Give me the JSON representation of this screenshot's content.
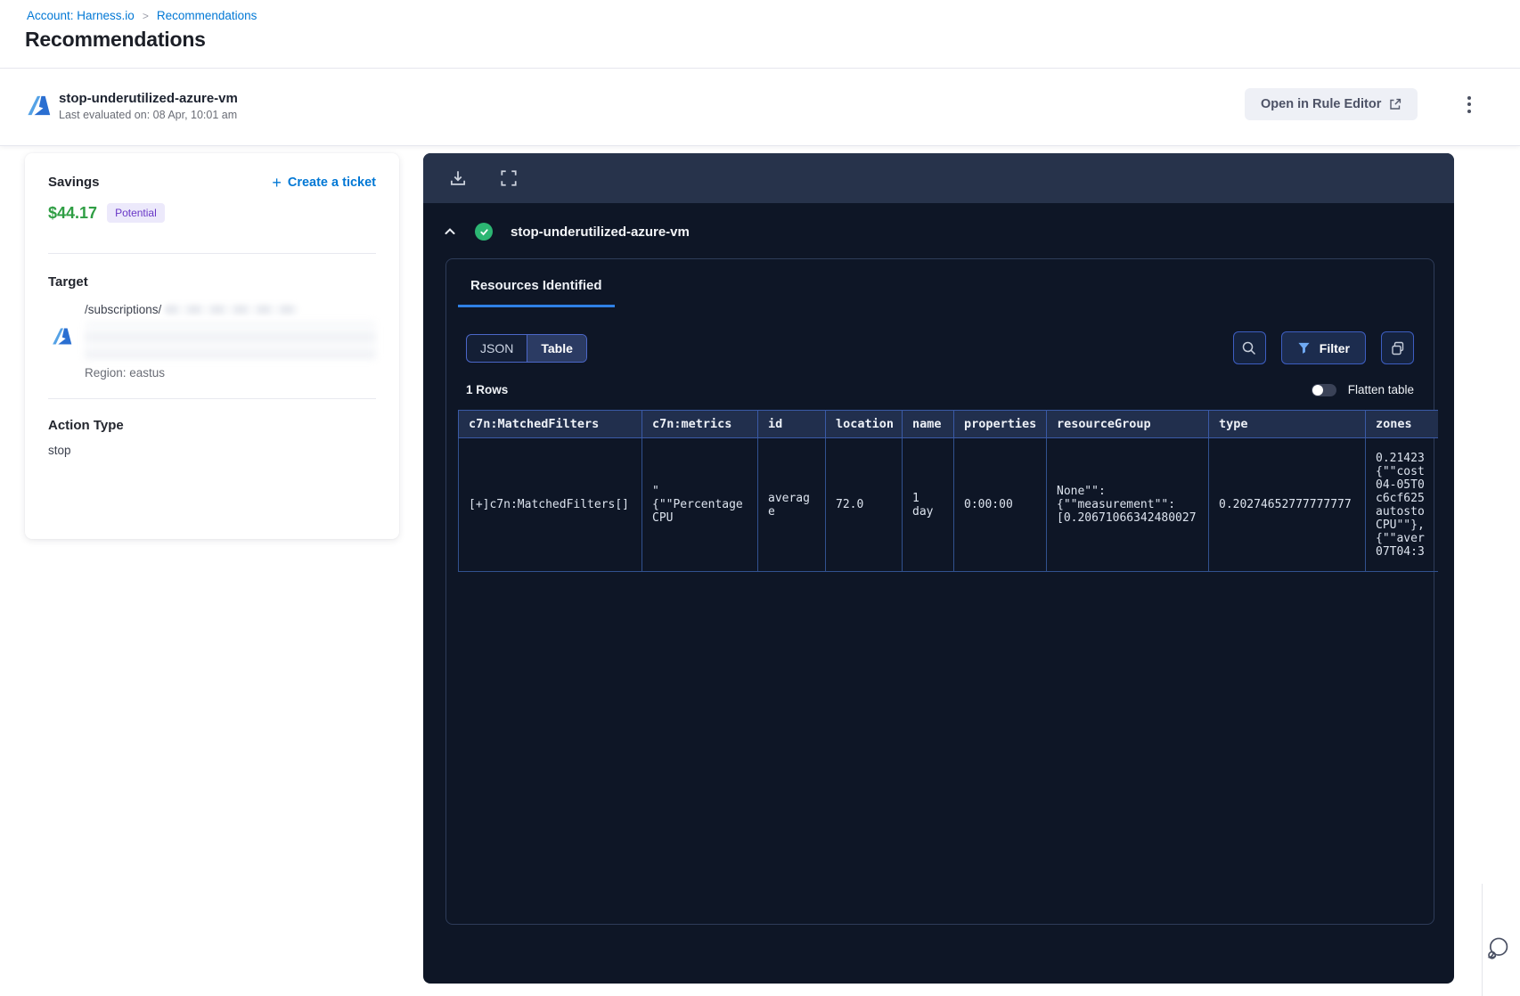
{
  "breadcrumb": {
    "account": "Account: Harness.io",
    "separator": ">",
    "current": "Recommendations"
  },
  "page": {
    "title": "Recommendations"
  },
  "recommendation_header": {
    "title": "stop-underutilized-azure-vm",
    "last_evaluated": "Last evaluated on: 08 Apr, 10:01 am",
    "open_rule_editor": "Open in Rule Editor"
  },
  "savings_card": {
    "savings_label": "Savings",
    "amount": "$44.17",
    "badge": "Potential",
    "plus": "+",
    "create_ticket": "Create a ticket",
    "target_label": "Target",
    "target_path": "/subscriptions/",
    "region": "Region: eastus",
    "action_type_label": "Action Type",
    "action_type_value": "stop"
  },
  "viewer": {
    "rule_title": "stop-underutilized-azure-vm",
    "tab_resources": "Resources Identified",
    "view_toggle": {
      "json": "JSON",
      "table": "Table",
      "selected": "Table"
    },
    "filter_label": "Filter",
    "rows_count": "1 Rows",
    "flatten_label": "Flatten table",
    "table": {
      "columns": [
        "c7n:MatchedFilters",
        "c7n:metrics",
        "id",
        "location",
        "name",
        "properties",
        "resourceGroup",
        "type",
        "zones"
      ],
      "rows": [
        {
          "matched_filters": "[+]c7n:MatchedFilters[]",
          "metrics": "\"\n{\"\"Percentage\nCPU",
          "id": "average",
          "location": "72.0",
          "name": "1\nday",
          "properties": "0:00:00",
          "resource_group": "None\"\":\n{\"\"measurement\"\":\n[0.20671066342480027",
          "type": "0.20274652777777777",
          "zones": "0.21423\n{\"\"cost\n04-05T0\nc6cf625\nautosto\nCPU\"\"},\n{\"\"aver\n07T04:3"
        }
      ]
    }
  },
  "colors": {
    "link_blue": "#0278d5",
    "savings_green": "#2f9e44",
    "badge_bg": "#ece9fb",
    "badge_text": "#6938c7",
    "panel_bg": "#0e1626",
    "panel_topbar": "#27334b",
    "tab_underline": "#2f80e5",
    "table_border": "#31518f",
    "success_green": "#2cb673",
    "cell_link": "#8fd2f3"
  }
}
